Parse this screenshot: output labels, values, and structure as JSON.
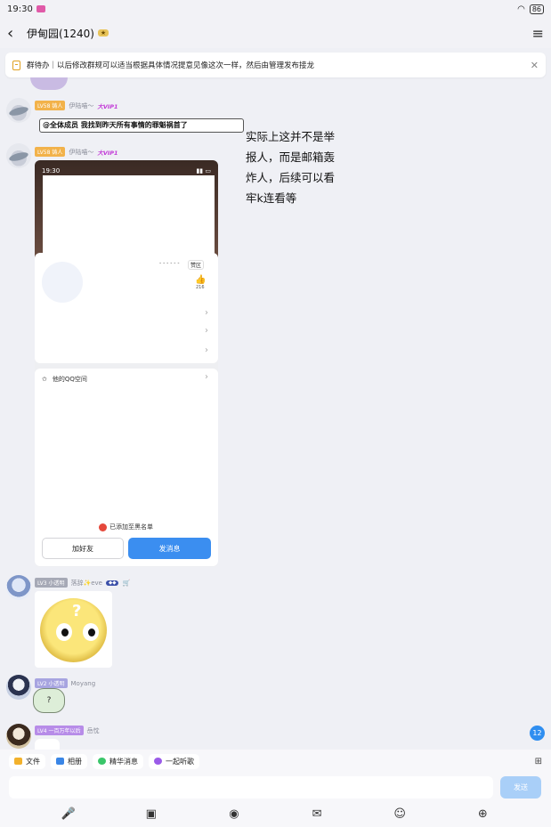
{
  "status_bar": {
    "time": "19:30",
    "battery": "86"
  },
  "header": {
    "title": "伊甸园(1240)",
    "badge": ""
  },
  "notice": {
    "text": "群待办｜以后修改群规可以适当根据具体情况提意见像这次一样，然后由管理发布接龙"
  },
  "messages": [
    {
      "level": "LV58 铸人",
      "name": "伊陆喵～",
      "vip": "大VIP1",
      "text": "@全体成员 我找到昨天所有事情的罪魁祸首了"
    },
    {
      "level": "LV58 铸人",
      "name": "伊陆喵～",
      "vip": "大VIP1"
    },
    {
      "level": "LV3 小透明",
      "name": "落辞✨eve",
      "tag": ""
    },
    {
      "level": "LV2 小透明",
      "name": "Moyang"
    },
    {
      "level": "LV4 一百万年以后",
      "name": "岳忱"
    }
  ],
  "overlay_text": [
    "实际上这并不是举",
    "报人，而是邮箱轰",
    "炸人，后续可以看",
    "牢k连看等"
  ],
  "screenshot": {
    "time": "19:30",
    "like_label": "赞区",
    "like_count": "216",
    "qzone": "他的QQ空间",
    "blacklist": "已添加至黑名单",
    "add_friend": "加好友",
    "send_message": "发消息"
  },
  "unread_count": "12",
  "quick_actions": [
    "文件",
    "相册",
    "精华消息",
    "一起听歌"
  ],
  "send_label": "发送",
  "toolbar_icons": [
    "microphone-icon",
    "image-icon",
    "camera-icon",
    "red-packet-icon",
    "emoji-icon",
    "plus-icon"
  ]
}
